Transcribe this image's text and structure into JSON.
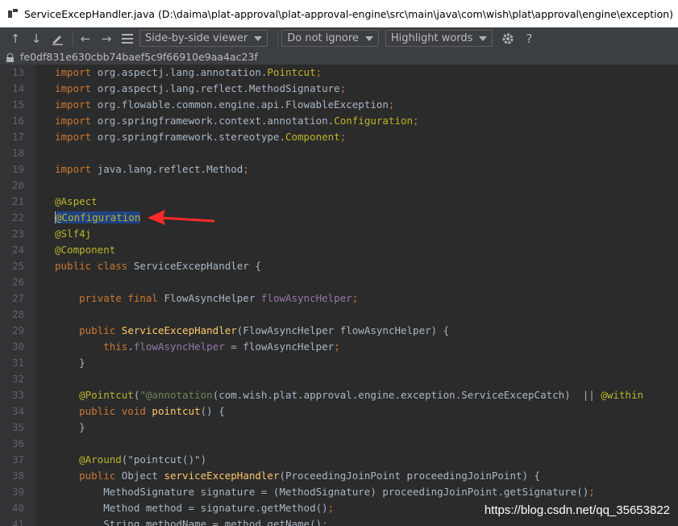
{
  "window": {
    "title": "ServiceExcepHandler.java (D:\\daima\\plat-approval\\plat-approval-engine\\src\\main\\java\\com\\wish\\plat\\approval\\engine\\exception)"
  },
  "toolbar": {
    "viewer_label": "Side-by-side viewer",
    "ignore_label": "Do not ignore",
    "highlight_label": "Highlight words",
    "help_label": "?"
  },
  "commit": {
    "hash": "fe0df831e630cbb74baef5c9f66910e9aa4ac23f"
  },
  "watermark": "https://blog.csdn.net/qq_35653822",
  "code_lines": [
    {
      "n": "13",
      "segs": [
        {
          "t": "import ",
          "c": "kw"
        },
        {
          "t": "org.aspectj.lang.annotation.",
          "c": ""
        },
        {
          "t": "Pointcut",
          "c": "ann"
        },
        {
          "t": ";",
          "c": "kw"
        }
      ]
    },
    {
      "n": "14",
      "segs": [
        {
          "t": "import ",
          "c": "kw"
        },
        {
          "t": "org.aspectj.lang.reflect.MethodSignature",
          "c": ""
        },
        {
          "t": ";",
          "c": "kw"
        }
      ]
    },
    {
      "n": "15",
      "segs": [
        {
          "t": "import ",
          "c": "kw"
        },
        {
          "t": "org.flowable.common.engine.api.FlowableException",
          "c": ""
        },
        {
          "t": ";",
          "c": "kw"
        }
      ]
    },
    {
      "n": "16",
      "segs": [
        {
          "t": "import ",
          "c": "kw"
        },
        {
          "t": "org.springframework.context.annotation.",
          "c": ""
        },
        {
          "t": "Configuration",
          "c": "ann"
        },
        {
          "t": ";",
          "c": "kw"
        }
      ]
    },
    {
      "n": "17",
      "segs": [
        {
          "t": "import ",
          "c": "kw"
        },
        {
          "t": "org.springframework.stereotype.",
          "c": ""
        },
        {
          "t": "Component",
          "c": "ann"
        },
        {
          "t": ";",
          "c": "kw"
        }
      ]
    },
    {
      "n": "18",
      "segs": []
    },
    {
      "n": "19",
      "segs": [
        {
          "t": "import ",
          "c": "kw"
        },
        {
          "t": "java.lang.reflect.Method",
          "c": ""
        },
        {
          "t": ";",
          "c": "kw"
        }
      ]
    },
    {
      "n": "20",
      "segs": []
    },
    {
      "n": "21",
      "segs": [
        {
          "t": "@Aspect",
          "c": "ann"
        }
      ]
    },
    {
      "n": "22",
      "segs": [
        {
          "t": "@Configuration",
          "c": "ann sel caret-line"
        }
      ]
    },
    {
      "n": "23",
      "segs": [
        {
          "t": "@Slf4j",
          "c": "ann"
        }
      ]
    },
    {
      "n": "24",
      "segs": [
        {
          "t": "@Component",
          "c": "ann"
        }
      ]
    },
    {
      "n": "25",
      "segs": [
        {
          "t": "public class ",
          "c": "kw"
        },
        {
          "t": "ServiceExcepHandler {",
          "c": ""
        }
      ]
    },
    {
      "n": "26",
      "segs": []
    },
    {
      "n": "27",
      "segs": [
        {
          "t": "    private final ",
          "c": "kw"
        },
        {
          "t": "FlowAsyncHelper ",
          "c": ""
        },
        {
          "t": "flowAsyncHelper",
          "c": "fld"
        },
        {
          "t": ";",
          "c": "kw"
        }
      ]
    },
    {
      "n": "28",
      "segs": []
    },
    {
      "n": "29",
      "segs": [
        {
          "t": "    public ",
          "c": "kw"
        },
        {
          "t": "ServiceExcepHandler",
          "c": "mth"
        },
        {
          "t": "(FlowAsyncHelper flowAsyncHelper) {",
          "c": ""
        }
      ]
    },
    {
      "n": "30",
      "segs": [
        {
          "t": "        this",
          "c": "kw"
        },
        {
          "t": ".",
          "c": ""
        },
        {
          "t": "flowAsyncHelper",
          "c": "fld"
        },
        {
          "t": " = flowAsyncHelper",
          "c": ""
        },
        {
          "t": ";",
          "c": "kw"
        }
      ]
    },
    {
      "n": "31",
      "segs": [
        {
          "t": "    }",
          "c": ""
        }
      ]
    },
    {
      "n": "32",
      "segs": []
    },
    {
      "n": "33",
      "segs": [
        {
          "t": "    @Pointcut",
          "c": "ann"
        },
        {
          "t": "(",
          "c": ""
        },
        {
          "t": "\"@annotation",
          "c": "str"
        },
        {
          "t": "(com.wish.plat.approval.engine.exception.ServiceExcepCatch)  || ",
          "c": ""
        },
        {
          "t": "@within",
          "c": "ann"
        }
      ]
    },
    {
      "n": "34",
      "segs": [
        {
          "t": "    public void ",
          "c": "kw"
        },
        {
          "t": "pointcut",
          "c": "mth"
        },
        {
          "t": "() {",
          "c": ""
        }
      ]
    },
    {
      "n": "35",
      "segs": [
        {
          "t": "    }",
          "c": ""
        }
      ]
    },
    {
      "n": "36",
      "segs": []
    },
    {
      "n": "37",
      "segs": [
        {
          "t": "    @Around",
          "c": "ann"
        },
        {
          "t": "(\"pointcut()\")",
          "c": ""
        }
      ]
    },
    {
      "n": "38",
      "segs": [
        {
          "t": "    public ",
          "c": "kw"
        },
        {
          "t": "Object ",
          "c": ""
        },
        {
          "t": "serviceExcepHandler",
          "c": "mth"
        },
        {
          "t": "(ProceedingJoinPoint proceedingJoinPoint) {",
          "c": ""
        }
      ]
    },
    {
      "n": "39",
      "segs": [
        {
          "t": "        MethodSignature signature = (MethodSignature) proceedingJoinPoint.getSignature()",
          "c": ""
        },
        {
          "t": ";",
          "c": "kw"
        }
      ]
    },
    {
      "n": "40",
      "segs": [
        {
          "t": "        Method method = signature.getMethod()",
          "c": ""
        },
        {
          "t": ";",
          "c": "kw"
        }
      ]
    },
    {
      "n": "41",
      "segs": [
        {
          "t": "        String methodName = method.getName()",
          "c": ""
        },
        {
          "t": ";",
          "c": "kw"
        }
      ]
    }
  ]
}
